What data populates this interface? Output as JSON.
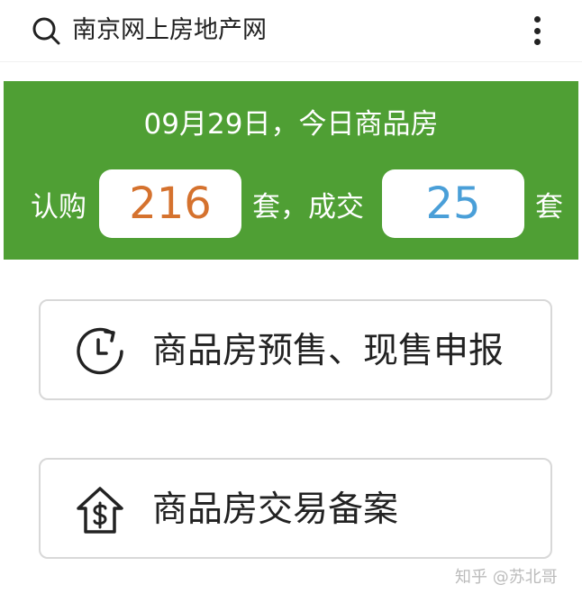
{
  "header": {
    "title": "南京网上房地产网",
    "search_icon": "search-icon",
    "more_icon": "more-vertical-icon"
  },
  "stats": {
    "heading": "09月29日，今日商品房",
    "subscribe_label": "认购",
    "subscribe_count": "216",
    "unit_separator": "套，成交",
    "deal_count": "25",
    "deal_unit": "套",
    "colors": {
      "banner": "#4f9f34",
      "subscribe_number": "#d5722e",
      "deal_number": "#4a9fd8"
    }
  },
  "menu": {
    "items": [
      {
        "label": "商品房预售、现售申报",
        "icon": "clock-refresh-icon"
      },
      {
        "label": "商品房交易备案",
        "icon": "house-dollar-icon"
      }
    ]
  },
  "watermark": {
    "text": "知乎 @苏北哥"
  }
}
